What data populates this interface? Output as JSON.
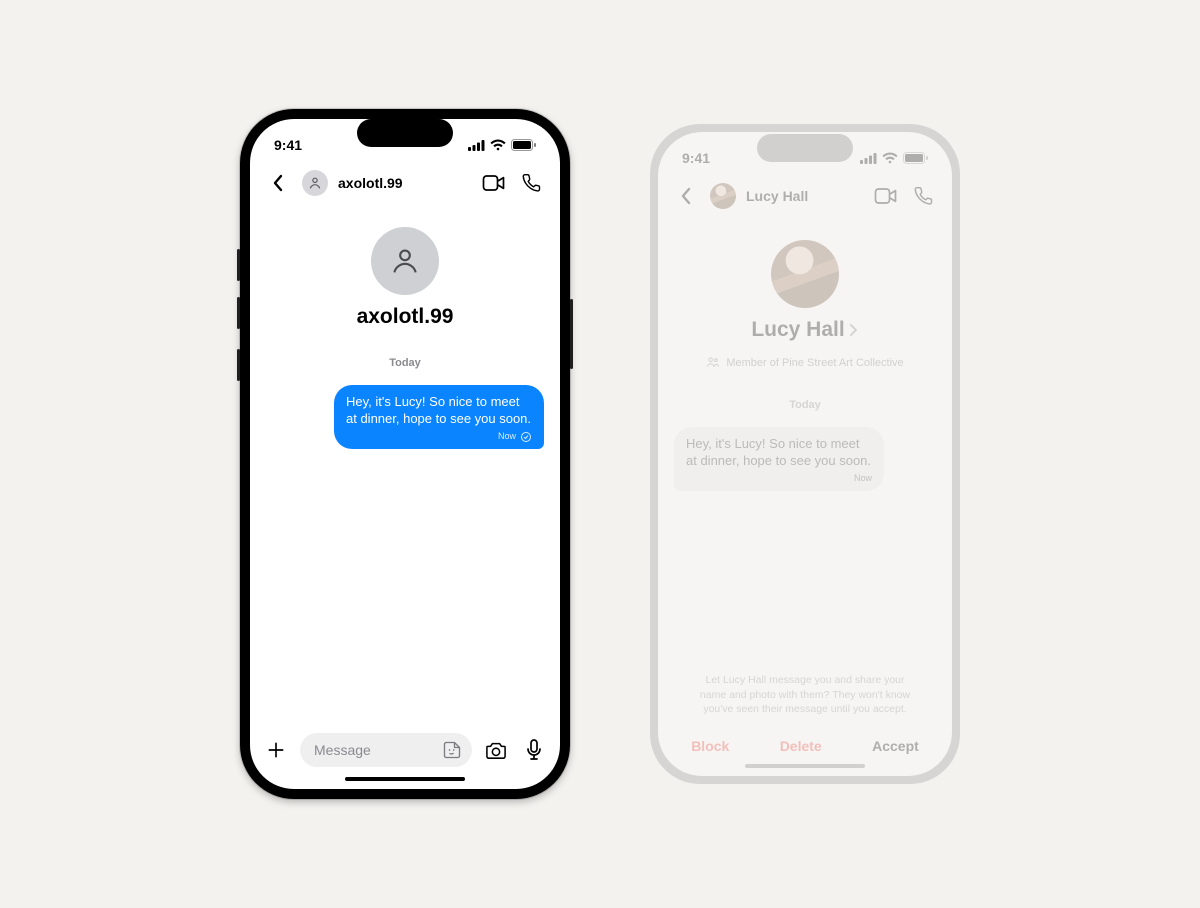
{
  "status": {
    "time": "9:41"
  },
  "left_phone": {
    "nav": {
      "title": "axolotl.99"
    },
    "contact": {
      "name": "axolotl.99"
    },
    "date_separator": "Today",
    "message": {
      "text": "Hey, it's Lucy! So nice to meet at dinner, hope to see you soon.",
      "meta": "Now"
    },
    "compose": {
      "placeholder": "Message"
    }
  },
  "right_phone": {
    "nav": {
      "title": "Lucy Hall"
    },
    "contact": {
      "name": "Lucy Hall",
      "member_of": "Member of Pine Street Art Collective"
    },
    "date_separator": "Today",
    "message": {
      "text": "Hey, it's Lucy! So nice to meet at dinner, hope to see you soon.",
      "meta": "Now"
    },
    "request_text": "Let Lucy Hall message you and share your name and photo with them? They won't know you've seen their message until you accept.",
    "actions": {
      "block": "Block",
      "delete": "Delete",
      "accept": "Accept"
    }
  }
}
